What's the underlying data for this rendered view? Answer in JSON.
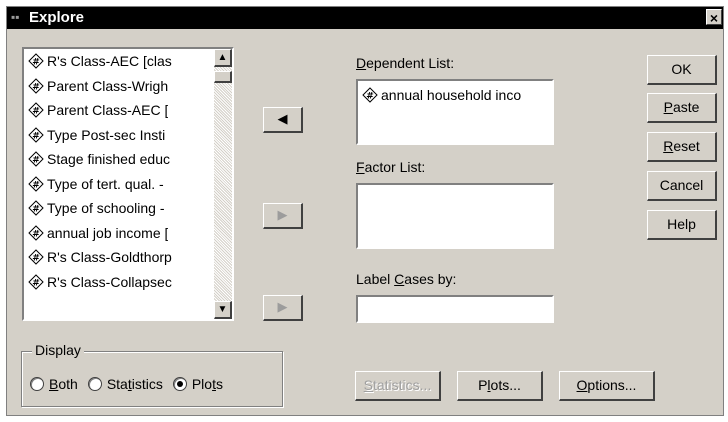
{
  "window": {
    "title": "Explore",
    "close_glyph": "×"
  },
  "variables": {
    "items": [
      {
        "label": "R's Class-AEC [clas",
        "icon": "numeric-variable-icon"
      },
      {
        "label": "Parent Class-Wrigh",
        "icon": "numeric-variable-icon"
      },
      {
        "label": "Parent Class-AEC [",
        "icon": "numeric-variable-icon"
      },
      {
        "label": "Type Post-sec Insti",
        "icon": "numeric-variable-icon"
      },
      {
        "label": "Stage finished educ",
        "icon": "numeric-variable-icon"
      },
      {
        "label": "Type of tert. qual. -",
        "icon": "numeric-variable-icon"
      },
      {
        "label": "Type of schooling -",
        "icon": "numeric-variable-icon"
      },
      {
        "label": "annual job income [",
        "icon": "numeric-variable-icon"
      },
      {
        "label": "R's Class-Goldthorp",
        "icon": "numeric-variable-icon"
      },
      {
        "label": "R's Class-Collapsec",
        "icon": "numeric-variable-icon"
      }
    ],
    "scroll_up_glyph": "▲",
    "scroll_down_glyph": "▼"
  },
  "move_buttons": {
    "dependent_glyph": "◀",
    "factor_glyph": "▶",
    "label_glyph": "▶"
  },
  "dependent_list": {
    "label_prefix": "",
    "label_hotkey": "D",
    "label_rest": "ependent List:",
    "items": [
      {
        "label": "annual household inco",
        "icon": "numeric-variable-icon"
      }
    ]
  },
  "factor_list": {
    "label_hotkey": "F",
    "label_rest": "actor List:"
  },
  "label_cases": {
    "label_prefix": "Label ",
    "label_hotkey": "C",
    "label_rest": "ases by:",
    "value": ""
  },
  "side_buttons": {
    "ok": "OK",
    "paste_hotkey": "P",
    "paste_rest": "aste",
    "reset_hotkey": "R",
    "reset_rest": "eset",
    "cancel": "Cancel",
    "help": "Help"
  },
  "display_group": {
    "title": "Display",
    "options": [
      {
        "hotkey": "B",
        "rest": "oth",
        "prefix": "",
        "checked": false
      },
      {
        "prefix": "Sta",
        "hotkey": "t",
        "rest": "istics",
        "checked": false
      },
      {
        "prefix": "Plo",
        "hotkey": "t",
        "rest": "s",
        "checked": true
      }
    ]
  },
  "bottom_buttons": {
    "statistics_hotkey": "S",
    "statistics_rest": "tatistics...",
    "plots_prefix": "P",
    "plots_hotkey": "l",
    "plots_rest": "ots...",
    "options_hotkey": "O",
    "options_rest": "ptions..."
  }
}
